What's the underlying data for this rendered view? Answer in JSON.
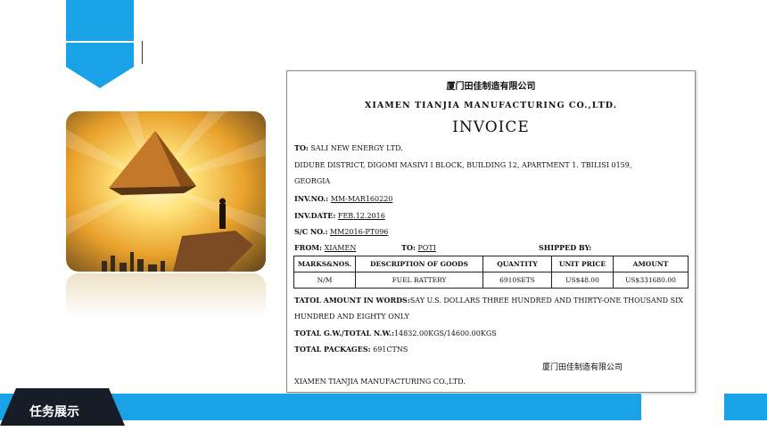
{
  "slide": {
    "section_label": "任务展示",
    "accent_color": "#1aa2e6"
  },
  "image": {
    "description_icon": "pyramid-photo"
  },
  "invoice": {
    "company_cn": "厦门田佳制造有限公司",
    "company_en": "XIAMEN TIANJIA MANUFACTURING CO.,LTD.",
    "doc_title": "INVOICE",
    "to_label": "TO:",
    "to_name": "SALI NEW ENERGY LTD.",
    "address_1": "DIDUBE DISTRICT, DIGOMI MASIVI I BLOCK, BUILDING 12, APARTMENT 1. TBILISI 0159,",
    "address_2": "GEORGIA",
    "inv_no_label": "INV.NO.:",
    "inv_no": "MM-MAR160220",
    "inv_date_label": "INV.DATE:",
    "inv_date": "FEB.12.2016",
    "sc_no_label": "S/C NO.:",
    "sc_no": "MM2016-PT096",
    "from_label": "FROM:",
    "from_value": "XIAMEN",
    "to2_label": "TO:",
    "to2_value": "POTI",
    "shipped_by_label": "SHIPPED BY:",
    "table_headers": [
      "MARKS&NOS.",
      "DESCRIPTION OF GOODS",
      "QUANTITY",
      "UNIT PRICE",
      "AMOUNT"
    ],
    "table_row": [
      "N/M",
      "FUEL BATTERY",
      "6910SETS",
      "US$48.00",
      "US$331680.00"
    ],
    "words_label": "TATOL AMOUNT IN WORDS:",
    "words_1": "SAY U.S. DOLLARS THREE HUNDRED AND THIRTY-ONE THOUSAND SIX",
    "words_2": "HUNDRED AND EIGHTY ONLY",
    "weight_label": "TOTAL G.W./TOTAL N.W.:",
    "weight_value": "14832.00KGS/14600.00KGS",
    "packages_label": "TOTAL PACKAGES:",
    "packages_value": "691CTNS",
    "signature_cn": "厦门田佳制造有限公司",
    "signature_en": "XIAMEN TIANJIA MANUFACTURING CO.,LTD."
  }
}
